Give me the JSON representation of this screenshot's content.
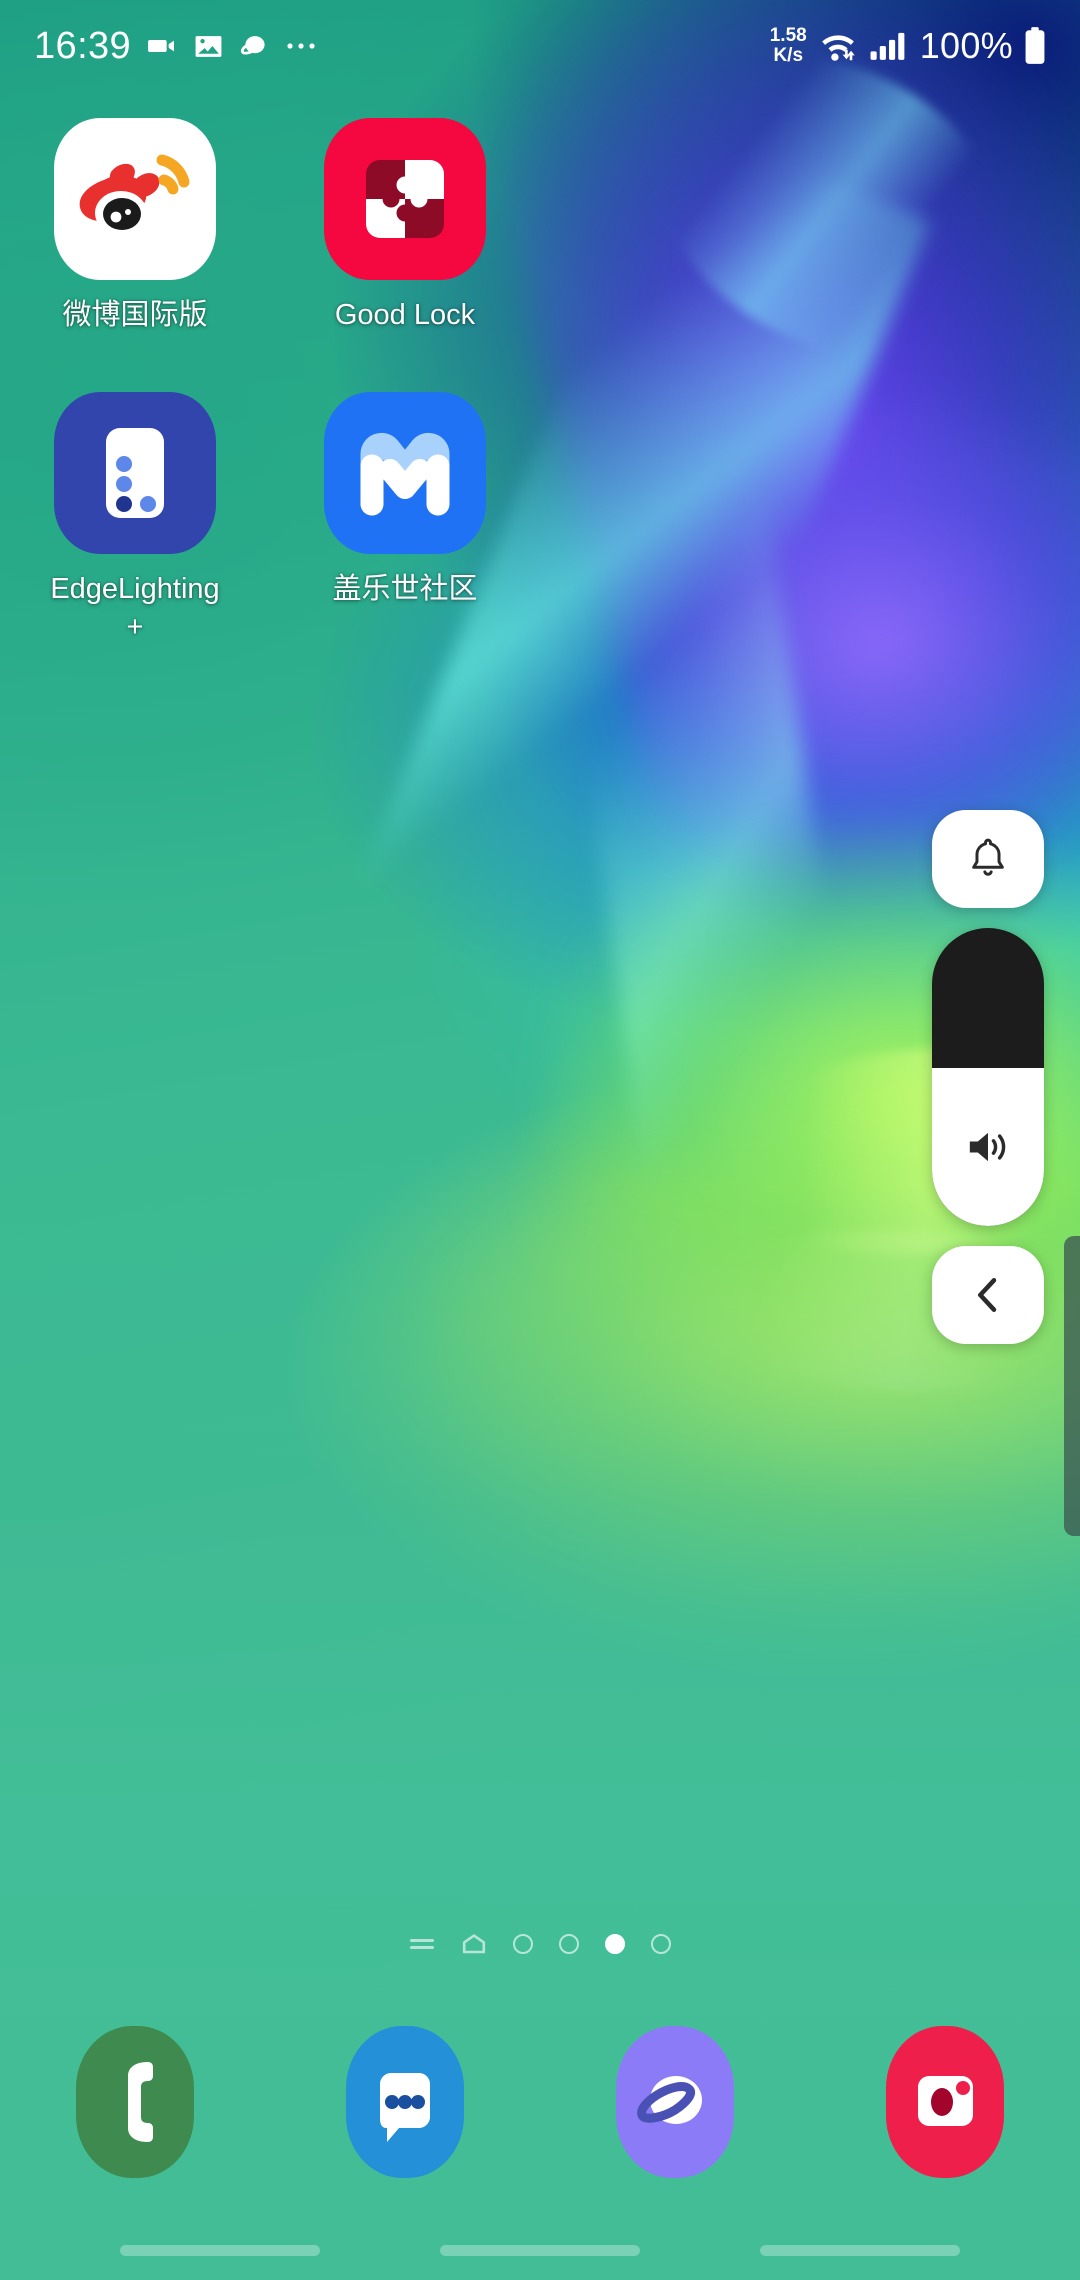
{
  "status_bar": {
    "clock": "16:39",
    "left_icons": [
      "video-recorder-icon",
      "gallery-icon",
      "samsung-internet-icon",
      "more-notifications-icon"
    ],
    "network_speed_value": "1.58",
    "network_speed_unit": "K/s",
    "right_icons": [
      "wifi-icon",
      "cellular-signal-icon"
    ],
    "battery_percent": "100%",
    "battery_icon": "battery-full-icon"
  },
  "home_screen": {
    "apps": [
      {
        "label": "微博国际版",
        "icon": "weibo-icon",
        "col": 1
      },
      {
        "label": "Good Lock",
        "icon": "good-lock-icon",
        "col": 2
      },
      {
        "label": "EdgeLighting",
        "label2": "+",
        "icon": "edge-lighting-icon",
        "col": 1
      },
      {
        "label": "盖乐世社区",
        "icon": "galaxy-community-icon",
        "col": 2
      }
    ]
  },
  "page_indicator": {
    "items": [
      {
        "type": "lines-icon",
        "active": false
      },
      {
        "type": "home-icon",
        "active": false
      },
      {
        "type": "dot",
        "active": false
      },
      {
        "type": "dot",
        "active": false
      },
      {
        "type": "dot",
        "active": true
      },
      {
        "type": "dot",
        "active": false
      }
    ],
    "current_page": 5,
    "total_pages": 6
  },
  "volume_panel": {
    "ringer_button": {
      "icon": "bell-icon",
      "label": "Ringtone mode"
    },
    "slider": {
      "icon": "volume-speaker-icon",
      "level_percent": 53,
      "track_color": "#1c1c1c",
      "fill_color": "#ffffff"
    },
    "expand_button": {
      "icon": "chevron-left-icon",
      "label": "More volume controls"
    }
  },
  "edge_panel_handle": {
    "label": "edge-panel-handle",
    "color": "#3c5a53"
  },
  "dock": {
    "apps": [
      {
        "label": "Phone",
        "icon": "phone-icon",
        "color": "#3f8a4e"
      },
      {
        "label": "Messages",
        "icon": "messages-icon",
        "color": "#2390d8"
      },
      {
        "label": "Internet",
        "icon": "internet-icon",
        "color": "#8b7bf7"
      },
      {
        "label": "Camera",
        "icon": "camera-icon",
        "color": "#ef1f4b"
      }
    ]
  },
  "nav_bar": {
    "buttons": [
      {
        "label": "Recents",
        "icon": "recents-pill"
      },
      {
        "label": "Home",
        "icon": "home-pill"
      },
      {
        "label": "Back",
        "icon": "back-pill"
      }
    ]
  },
  "colors": {
    "accent_green": "#43bd96",
    "weibo_red": "#e8302f",
    "weibo_orange": "#f5a623",
    "good_lock_red": "#f5073f",
    "edge_blue": "#3145ad",
    "galaxy_blue": "#2072f5"
  }
}
